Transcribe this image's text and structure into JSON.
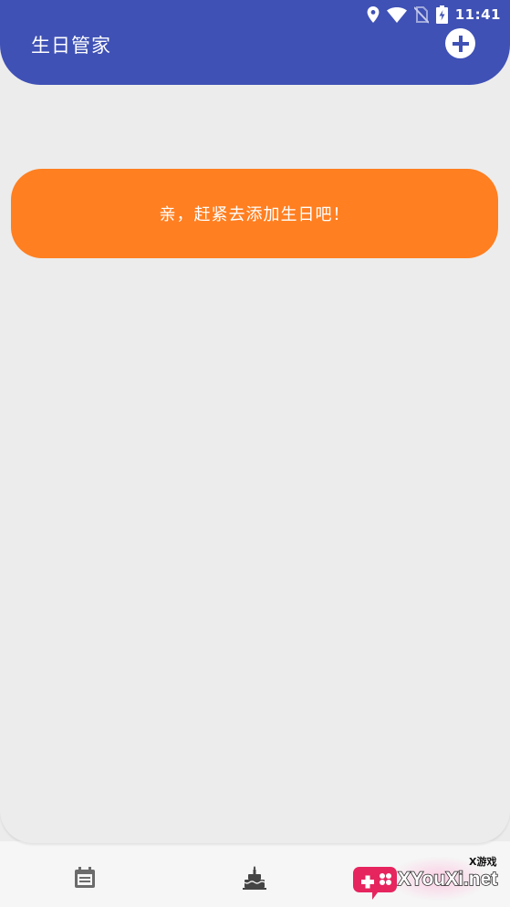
{
  "status_bar": {
    "time": "11:41",
    "icons": [
      "location-icon",
      "wifi-icon",
      "no-sim-icon",
      "battery-charging-icon"
    ]
  },
  "app_bar": {
    "title": "生日管家",
    "add_icon": "plus-circle-icon"
  },
  "empty_state": {
    "message": "亲，赶紧去添加生日吧！"
  },
  "bottom_nav": {
    "items": [
      {
        "icon": "calendar-icon"
      },
      {
        "icon": "birthday-cake-icon"
      }
    ]
  },
  "watermark": {
    "top_text": "X游戏",
    "site_text": "XYouXi.net"
  },
  "colors": {
    "app_bar": "#3f51b5",
    "card": "#ff7f21",
    "background": "#ececec"
  }
}
